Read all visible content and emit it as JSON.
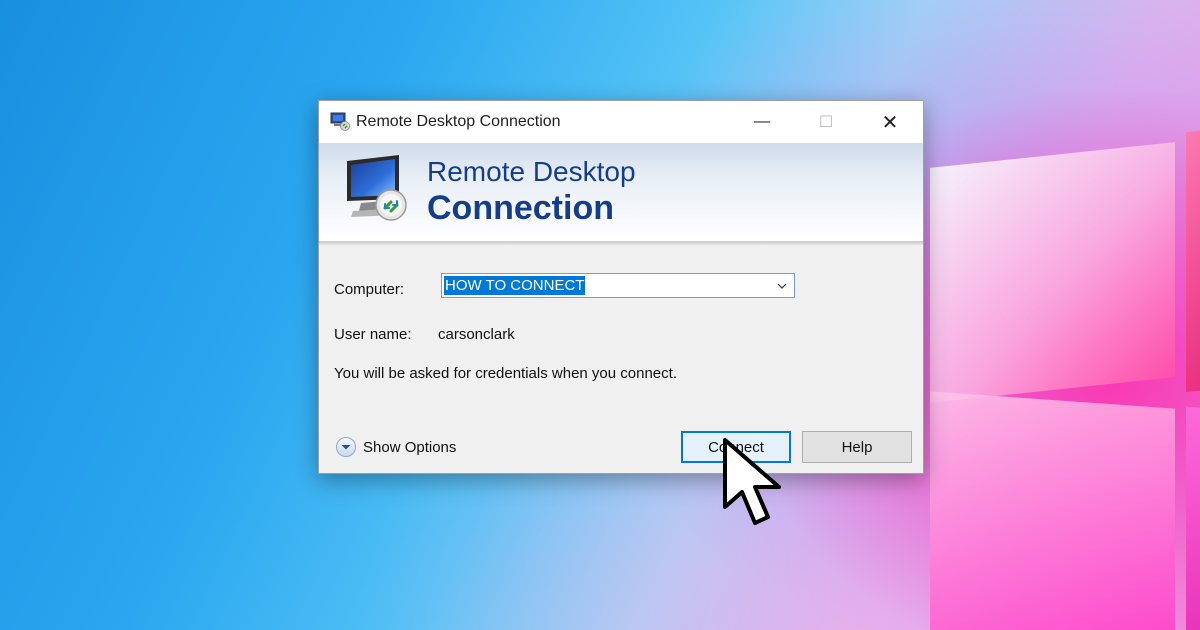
{
  "window": {
    "title": "Remote Desktop Connection",
    "minimize_glyph": "—",
    "maximize_glyph": "☐",
    "close_glyph": "✕"
  },
  "banner": {
    "line1": "Remote Desktop",
    "line2": "Connection"
  },
  "form": {
    "computer_label": "Computer:",
    "computer_value": "HOW TO CONNECT",
    "username_label": "User name:",
    "username_value": "carsonclark",
    "info": "You will be asked for credentials when you connect."
  },
  "footer": {
    "show_options": "Show Options",
    "connect": "Connect",
    "help": "Help"
  },
  "icons": {
    "app": "remote-desktop-icon",
    "dropdown": "chevron-down-icon",
    "options": "chevron-down-circle-icon",
    "pointer": "mouse-pointer-icon"
  },
  "colors": {
    "selection": "#0078d7",
    "banner_text": "#143e8a",
    "dialog_bg": "#f0f0f0"
  }
}
